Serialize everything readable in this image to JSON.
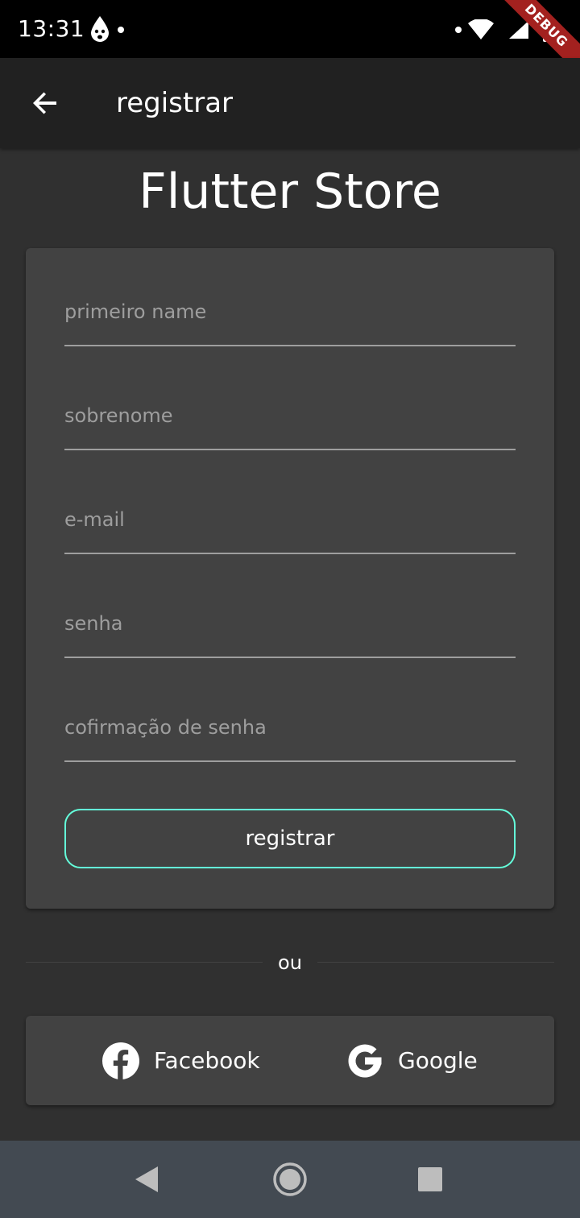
{
  "status_bar": {
    "time": "13:31",
    "debug_label": "DEBUG"
  },
  "app_bar": {
    "title": "registrar",
    "back_icon": "arrow-left-icon"
  },
  "page": {
    "title": "Flutter Store"
  },
  "form": {
    "fields": [
      {
        "placeholder": "primeiro name",
        "value": ""
      },
      {
        "placeholder": "sobrenome",
        "value": ""
      },
      {
        "placeholder": "e-mail",
        "value": ""
      },
      {
        "placeholder": "senha",
        "value": ""
      },
      {
        "placeholder": "cofirmação de senha",
        "value": ""
      }
    ],
    "submit_label": "registrar"
  },
  "divider": {
    "text": "ou"
  },
  "social": {
    "facebook_label": "Facebook",
    "google_label": "Google"
  },
  "colors": {
    "background": "#303030",
    "app_bar": "#212121",
    "card": "#424242",
    "accent": "#64ffda",
    "placeholder": "#9e9e9e",
    "nav_bar": "#434a52",
    "debug_banner": "#a3211f"
  }
}
